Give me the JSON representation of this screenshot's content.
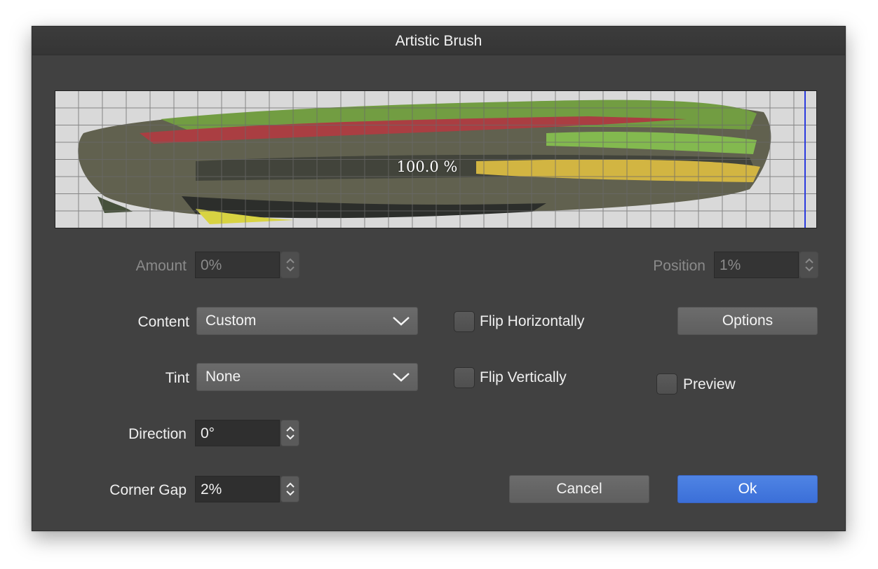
{
  "window": {
    "title": "Artistic Brush"
  },
  "preview": {
    "percent_label": "100.0 %"
  },
  "amount": {
    "label": "Amount",
    "value": "0%"
  },
  "position": {
    "label": "Position",
    "value": "1%"
  },
  "content": {
    "label": "Content",
    "selected": "Custom"
  },
  "tint": {
    "label": "Tint",
    "selected": "None"
  },
  "direction": {
    "label": "Direction",
    "value": "0°"
  },
  "corner_gap": {
    "label": "Corner Gap",
    "value": "2%"
  },
  "flip_horizontally": {
    "label": "Flip Horizontally",
    "checked": false
  },
  "flip_vertically": {
    "label": "Flip Vertically",
    "checked": false
  },
  "preview_toggle": {
    "label": "Preview",
    "checked": false
  },
  "buttons": {
    "options": "Options",
    "cancel": "Cancel",
    "ok": "Ok"
  },
  "colors": {
    "accent": "#3b6fd8",
    "dialog_bg": "#414141",
    "marker": "#2a3adf"
  }
}
